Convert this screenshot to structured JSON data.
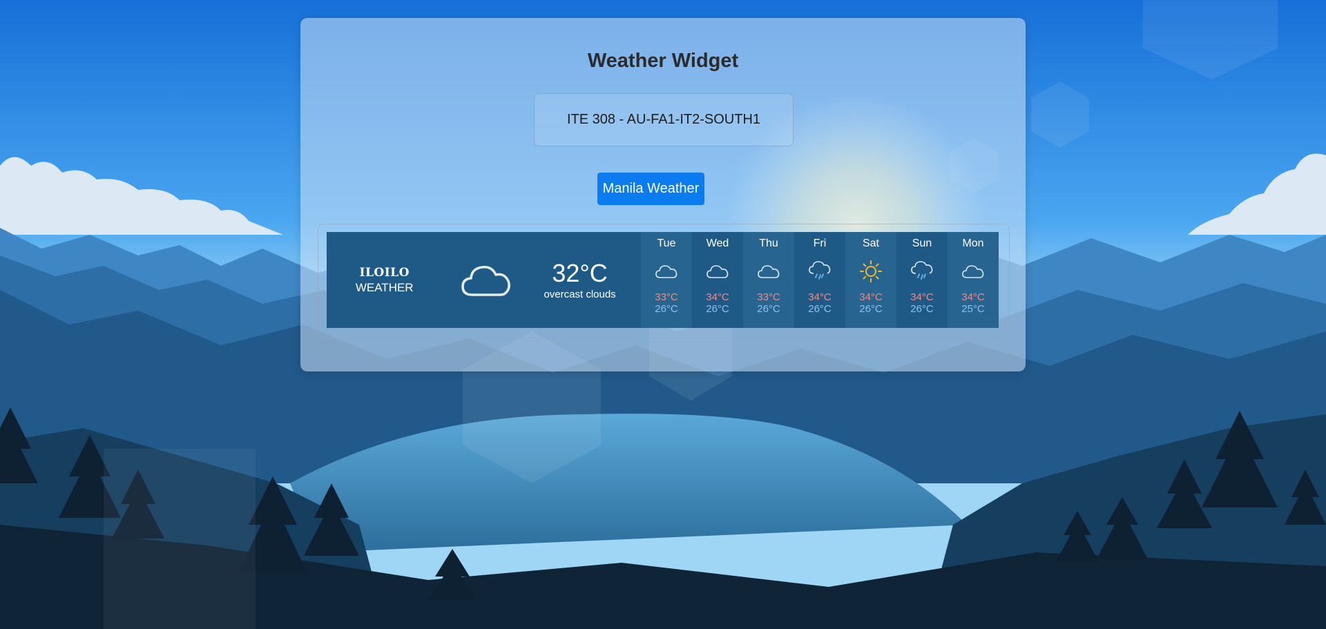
{
  "page": {
    "title": "Weather Widget"
  },
  "course_label": "ITE 308 - AU-FA1-IT2-SOUTH1",
  "action_button": {
    "label": "Manila Weather"
  },
  "current": {
    "city": "ILOILO",
    "label": "WEATHER",
    "icon": "cloud-icon",
    "temperature": "32°C",
    "description": "overcast clouds"
  },
  "forecast": [
    {
      "day": "Tue",
      "icon": "cloud-icon",
      "high": "33°C",
      "low": "26°C"
    },
    {
      "day": "Wed",
      "icon": "cloud-icon",
      "high": "34°C",
      "low": "26°C"
    },
    {
      "day": "Thu",
      "icon": "cloud-icon",
      "high": "33°C",
      "low": "26°C"
    },
    {
      "day": "Fri",
      "icon": "rain-cloud-icon",
      "high": "34°C",
      "low": "26°C"
    },
    {
      "day": "Sat",
      "icon": "sun-icon",
      "high": "34°C",
      "low": "26°C"
    },
    {
      "day": "Sun",
      "icon": "rain-cloud-icon",
      "high": "34°C",
      "low": "26°C"
    },
    {
      "day": "Mon",
      "icon": "cloud-icon",
      "high": "34°C",
      "low": "25°C"
    }
  ],
  "colors": {
    "accent": "#0b7bf0",
    "widget_bg": "#1f5a86",
    "high_temp": "#f08a8a",
    "low_temp": "#8ec1f0",
    "sun": "#f5b82e"
  }
}
